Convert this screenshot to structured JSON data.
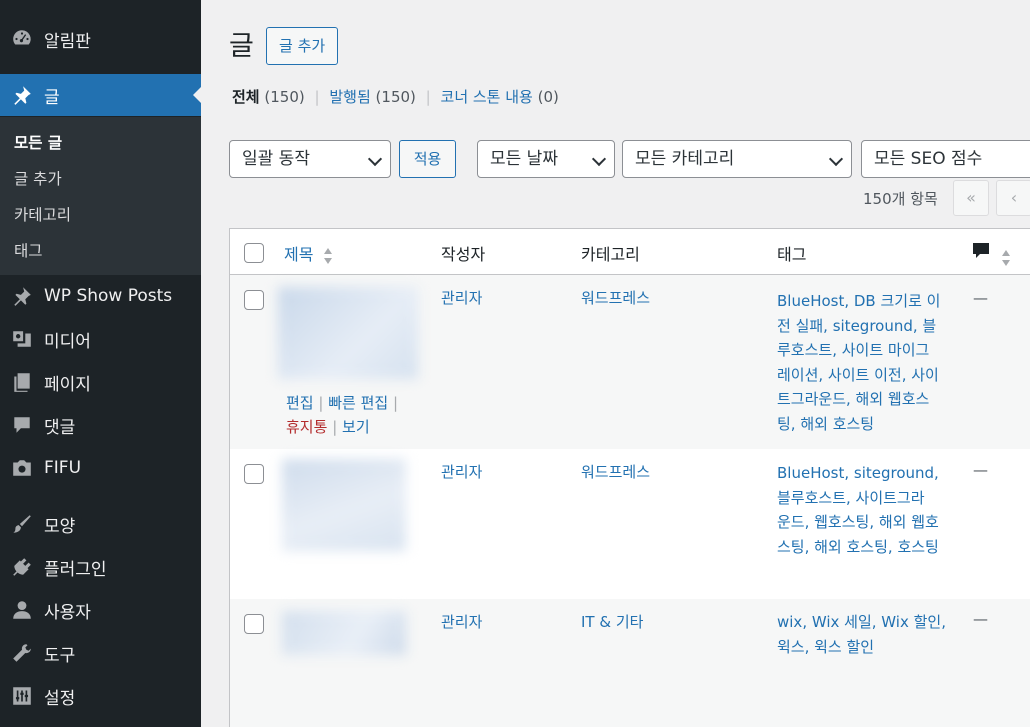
{
  "sidebar": {
    "items": [
      {
        "label": "알림판",
        "icon": "dashboard-icon"
      },
      {
        "label": "글",
        "icon": "pin-icon"
      },
      {
        "label": "WP Show Posts",
        "icon": "pin-icon"
      },
      {
        "label": "미디어",
        "icon": "media-icon"
      },
      {
        "label": "페이지",
        "icon": "page-icon"
      },
      {
        "label": "댓글",
        "icon": "comment-icon"
      },
      {
        "label": "FIFU",
        "icon": "camera-icon"
      },
      {
        "label": "모양",
        "icon": "brush-icon"
      },
      {
        "label": "플러그인",
        "icon": "plugin-icon"
      },
      {
        "label": "사용자",
        "icon": "user-icon"
      },
      {
        "label": "도구",
        "icon": "wrench-icon"
      },
      {
        "label": "설정",
        "icon": "settings-icon"
      }
    ],
    "submenu": [
      "모든 글",
      "글 추가",
      "카테고리",
      "태그"
    ]
  },
  "header": {
    "title": "글",
    "add_new": "글 추가"
  },
  "views": {
    "all_label": "전체",
    "all_count": "(150)",
    "published_label": "발행됨",
    "published_count": "(150)",
    "cornerstone_label": "코너 스톤 내용",
    "cornerstone_count": "(0)",
    "separator": "|"
  },
  "filters": {
    "bulk_action": "일괄 동작",
    "apply": "적용",
    "date": "모든 날짜",
    "category": "모든 카테고리",
    "seo": "모든 SEO 점수"
  },
  "pagination": {
    "items_count": "150개 항목",
    "first": "«",
    "prev": "‹"
  },
  "table": {
    "columns": {
      "title": "제목",
      "author": "작성자",
      "category": "카테고리",
      "tags": "태그"
    },
    "row_actions": {
      "edit": "편집",
      "quick_edit": "빠른 편집",
      "trash": "휴지통",
      "view": "보기",
      "sep": "|"
    },
    "rows": [
      {
        "author": "관리자",
        "category": "워드프레스",
        "tags": [
          "BlueHost, DB 크기로 이",
          "전 실패, siteground, 블",
          "루호스트, 사이트 마이그",
          "레이션, 사이트 이전, 사이",
          "트그라운드, 해외 웹호스",
          "팅, 해외 호스팅"
        ],
        "comments": "—"
      },
      {
        "author": "관리자",
        "category": "워드프레스",
        "tags": [
          "BlueHost, siteground,",
          "블루호스트, 사이트그라",
          "운드, 웹호스팅, 해외 웹호",
          "스팅, 해외 호스팅, 호스팅"
        ],
        "comments": "—"
      },
      {
        "author": "관리자",
        "category": "IT & 기타",
        "tags": [
          "wix, Wix 세일, Wix 할인,",
          "윅스, 윅스 할인"
        ],
        "comments": "—"
      }
    ]
  },
  "colors": {
    "sidebar_bg": "#1d2327",
    "accent": "#2271b1",
    "link": "#2271b1",
    "trash": "#b32d2e"
  }
}
